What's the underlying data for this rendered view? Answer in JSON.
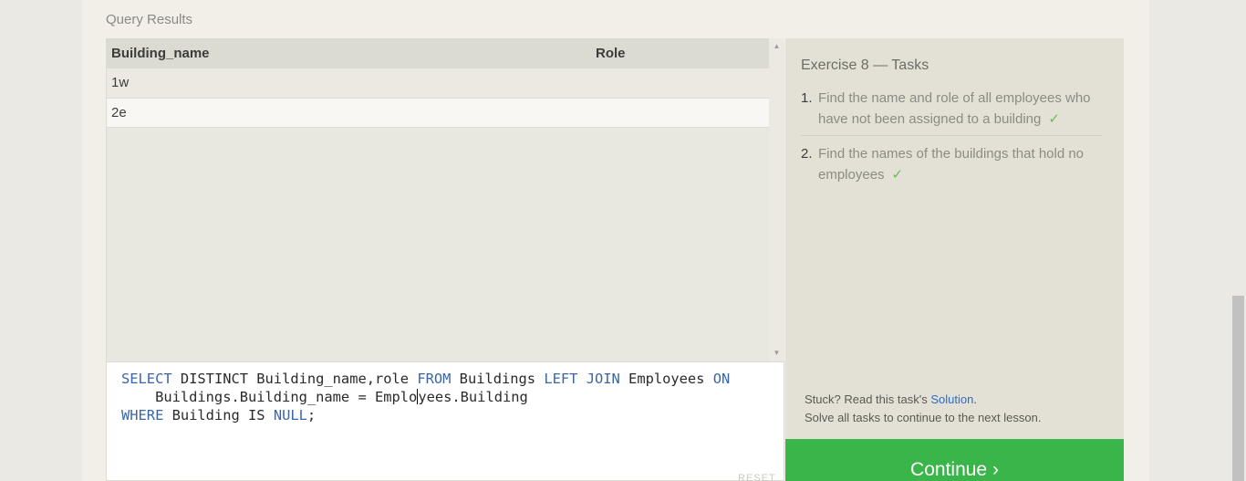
{
  "section_label": "Query Results",
  "results": {
    "columns": [
      "Building_name",
      "Role"
    ],
    "rows": [
      [
        "1w",
        ""
      ],
      [
        "2e",
        ""
      ]
    ]
  },
  "editor": {
    "line1": {
      "a": "SELECT",
      "b": " DISTINCT Building_name,role ",
      "c": "FROM",
      "d": " Buildings ",
      "e": "LEFT",
      "f": " ",
      "g": "JOIN",
      "h": " Employees ",
      "i": "ON"
    },
    "line2": {
      "pre": "    Buildings.Building_name = Emplo",
      "post": "yees.Building"
    },
    "line3": {
      "a": "WHERE",
      "b": " Building IS ",
      "c": "NULL",
      "d": ";"
    },
    "reset_label": "RESET"
  },
  "tasks": {
    "title": "Exercise 8 — Tasks",
    "items": [
      {
        "num": "1.",
        "text": "Find the name and role of all employees who have not been assigned to a building",
        "check": "✓"
      },
      {
        "num": "2.",
        "text": "Find the names of the buildings that hold no employees",
        "check": "✓"
      }
    ],
    "help_prefix": "Stuck? Read this task's ",
    "help_link": "Solution",
    "help_suffix": ".",
    "help_line2": "Solve all tasks to continue to the next lesson."
  },
  "continue_label": "Continue ›",
  "icons": {
    "scroll_up": "scroll-up-arrow-icon",
    "scroll_down": "scroll-down-arrow-icon"
  }
}
